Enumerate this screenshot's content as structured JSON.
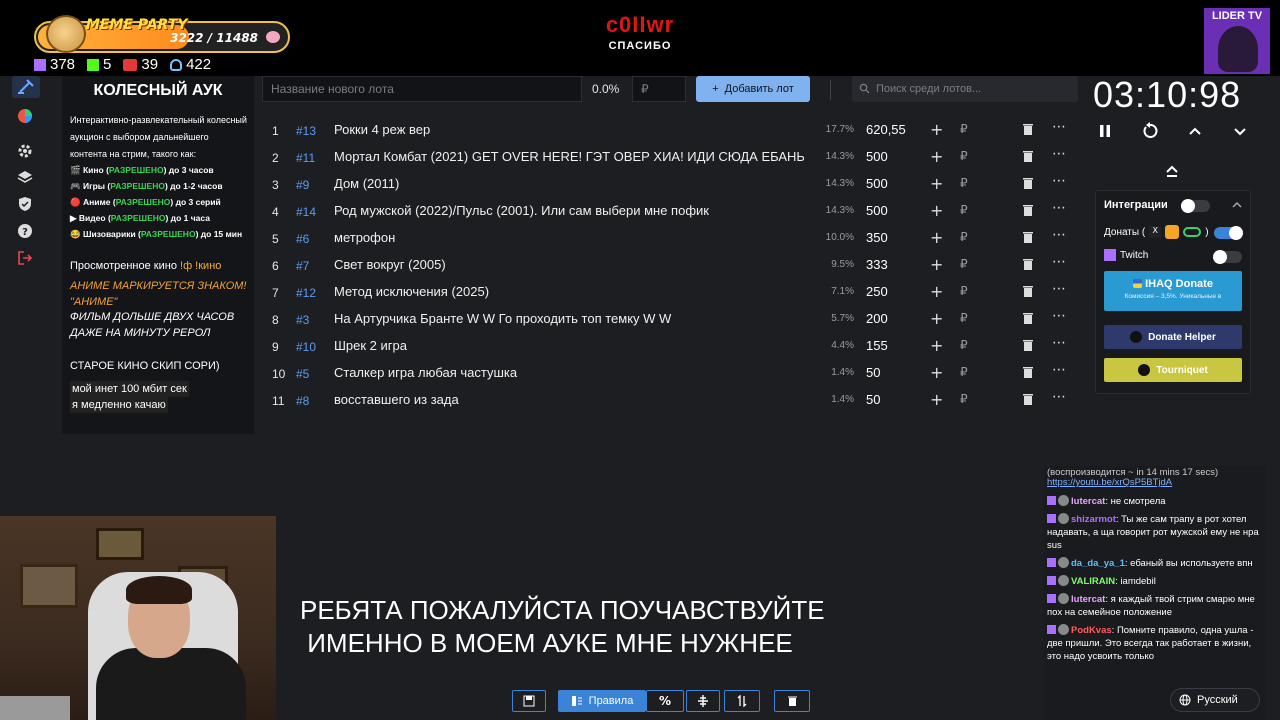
{
  "overlay": {
    "meme_party": {
      "title": "MEME PARTY",
      "progress": "3222 / 11488",
      "progress_fraction": 0.28
    },
    "stats": [
      {
        "icon": "twitch-icon",
        "value": "378"
      },
      {
        "icon": "kick-icon",
        "value": "5"
      },
      {
        "icon": "vk-live-icon",
        "value": "39"
      },
      {
        "icon": "viewers-icon",
        "value": "422"
      }
    ],
    "brand": {
      "name": "c0IIwr",
      "subtitle": "СПАСИБО"
    },
    "lider_label": "LIDER TV"
  },
  "left_panel": {
    "title": "КОЛЕСНЫЙ АУК",
    "description": "Интерактивно-развлекательный колесный аукцион с выбором дальнейшего контента на стрим, такого как:",
    "rules": [
      {
        "icon": "🎬",
        "pre": "Кино (",
        "ok": "РАЗРЕШЕНО",
        "post": ") до 3 часов"
      },
      {
        "icon": "🎮",
        "pre": "Игры (",
        "ok": "РАЗРЕШЕНО",
        "post": ") до 1-2 часов"
      },
      {
        "icon": "🔴",
        "pre": "Аниме (",
        "ok": "РАЗРЕШЕНО",
        "post": ") до 3 серий"
      },
      {
        "icon": "▶",
        "pre": "Видео (",
        "ok": "РАЗРЕШЕНО",
        "post": ") до 1 часа"
      },
      {
        "icon": "😂",
        "pre": "Шизоварики (",
        "ok": "РАЗРЕШЕНО",
        "post": ") до 15 мин"
      }
    ],
    "watched_label": "Просмотренное кино",
    "watched_cmd": "!ф !кино",
    "anime_note": [
      "АНИМЕ МАРКИРУЕТСЯ ЗНАКОМ!",
      "\"АНИМЕ\""
    ],
    "long_films": [
      "ФИЛЬМ ДОЛЬШЕ ДВУХ ЧАСОВ",
      "ДАЖЕ НА МИНУТУ РЕРОЛ"
    ],
    "old_skip": "СТАРОЕ КИНО СКИП СОРИ)",
    "internet": [
      "мой инет 100 мбит сек",
      "я медленно качаю"
    ]
  },
  "add_bar": {
    "name_placeholder": "Название нового лота",
    "percent": "0.0%",
    "amount_placeholder": "₽",
    "add_label": "Добавить лот",
    "search_placeholder": "Поиск среди лотов..."
  },
  "lots": [
    {
      "n": "1",
      "id": "#13",
      "name": "Рокки 4 реж вер",
      "pct": "17.7%",
      "amount": "620,55"
    },
    {
      "n": "2",
      "id": "#11",
      "name": "Мортал Комбат (2021) GET OVER HERE! ГЭТ ОВЕР ХИА! ИДИ СЮДА ЕБАНЫЙ",
      "pct": "14.3%",
      "amount": "500"
    },
    {
      "n": "3",
      "id": "#9",
      "name": "Дом (2011)",
      "pct": "14.3%",
      "amount": "500"
    },
    {
      "n": "4",
      "id": "#14",
      "name": "Род мужской (2022)/Пульс (2001). Или сам выбери мне пофик",
      "pct": "14.3%",
      "amount": "500"
    },
    {
      "n": "5",
      "id": "#6",
      "name": "метрофон",
      "pct": "10.0%",
      "amount": "350"
    },
    {
      "n": "6",
      "id": "#7",
      "name": "Свет вокруг (2005)",
      "pct": "9.5%",
      "amount": "333"
    },
    {
      "n": "7",
      "id": "#12",
      "name": "Метод исключения (2025)",
      "pct": "7.1%",
      "amount": "250"
    },
    {
      "n": "8",
      "id": "#3",
      "name": "На Артурчика Бранте W W Го проходить топ темку W W",
      "pct": "5.7%",
      "amount": "200"
    },
    {
      "n": "9",
      "id": "#10",
      "name": "Шрек 2 игра",
      "pct": "4.4%",
      "amount": "155"
    },
    {
      "n": "10",
      "id": "#5",
      "name": "Сталкер игра любая частушка",
      "pct": "1.4%",
      "amount": "50"
    },
    {
      "n": "11",
      "id": "#8",
      "name": "восставшего из зада",
      "pct": "1.4%",
      "amount": "50"
    }
  ],
  "currency_symbol": "₽",
  "timer": "03:10:98",
  "integrations": {
    "title": "Интеграции",
    "donations_label": "Донаты (",
    "donations_suffix": ")",
    "twitch_label": "Twitch",
    "ihaq_title": "IHAQ Donate",
    "ihaq_sub": "Комиссия – 3,5%. Уникальные в",
    "donate_helper": "Donate Helper",
    "tourniquet": "Tourniquet",
    "accent": "#2a9ad3"
  },
  "chat": {
    "cut_line": "(воспроизводится ~ in 14 mins 17 secs)",
    "link": "https://youtu.be/xrQsP5BTjdA",
    "messages": [
      {
        "user": "lutercat",
        "color": "#e9a6ff",
        "text": "не смотрела"
      },
      {
        "user": "shizarmot",
        "color": "#a970ff",
        "text": "Ты же сам трапу в рот хотел надавать, а ща говорит рот мужской ему не нра sus"
      },
      {
        "user": "da_da_ya_1",
        "color": "#5bc0ff",
        "text": "ебаный вы используете впн"
      },
      {
        "user": "VALIRAIN",
        "color": "#7cff6b",
        "text": "iamdebil"
      },
      {
        "user": "lutercat",
        "color": "#e9a6ff",
        "text": "я каждый твой стрим смарю мне пох на семейное положение"
      },
      {
        "user": "PodKvas",
        "color": "#ff5b5b",
        "text": "Помните правило, одна ушла - две пришли. Это всегда так работает в жизни, это надо усвоить только"
      }
    ]
  },
  "language": "Русский",
  "subtitle": [
    "РЕБЯТА ПОЖАЛУЙСТА ПОУЧАВСТВУЙТЕ",
    " ИМЕННО В МОЕМ АУКЕ МНЕ НУЖНЕЕ"
  ],
  "bottom_bar": {
    "rules_label": "Правила"
  }
}
